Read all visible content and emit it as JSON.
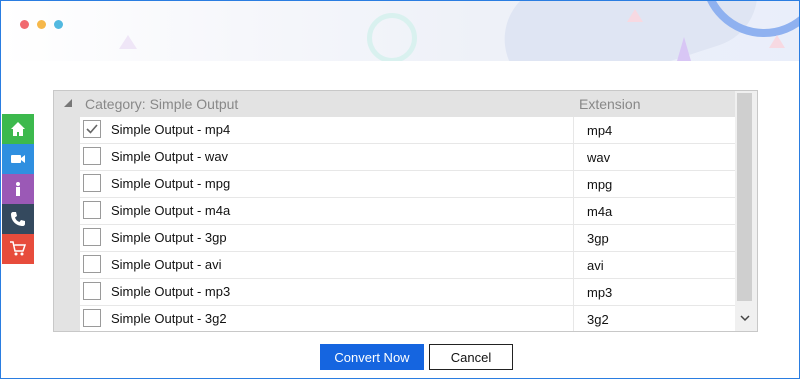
{
  "window": {
    "dots": [
      "#f16a6f",
      "#f6b84a",
      "#52b9e0"
    ]
  },
  "sidebar": {
    "items": [
      {
        "icon": "home-icon",
        "color": "#3cb94d"
      },
      {
        "icon": "video-camera-icon",
        "color": "#2f8fe0"
      },
      {
        "icon": "info-icon",
        "color": "#9b59b6"
      },
      {
        "icon": "phone-icon",
        "color": "#34495e"
      },
      {
        "icon": "cart-icon",
        "color": "#e74c3c"
      }
    ]
  },
  "grid": {
    "category_header": "Category: Simple Output",
    "extension_header": "Extension",
    "rows": [
      {
        "name": "Simple Output - mp4",
        "ext": "mp4",
        "checked": true
      },
      {
        "name": "Simple Output - wav",
        "ext": "wav",
        "checked": false
      },
      {
        "name": "Simple Output - mpg",
        "ext": "mpg",
        "checked": false
      },
      {
        "name": "Simple Output - m4a",
        "ext": "m4a",
        "checked": false
      },
      {
        "name": "Simple Output - 3gp",
        "ext": "3gp",
        "checked": false
      },
      {
        "name": "Simple Output - avi",
        "ext": "avi",
        "checked": false
      },
      {
        "name": "Simple Output - mp3",
        "ext": "mp3",
        "checked": false
      },
      {
        "name": "Simple Output - 3g2",
        "ext": "3g2",
        "checked": false
      }
    ]
  },
  "actions": {
    "convert_label": "Convert Now",
    "cancel_label": "Cancel"
  }
}
